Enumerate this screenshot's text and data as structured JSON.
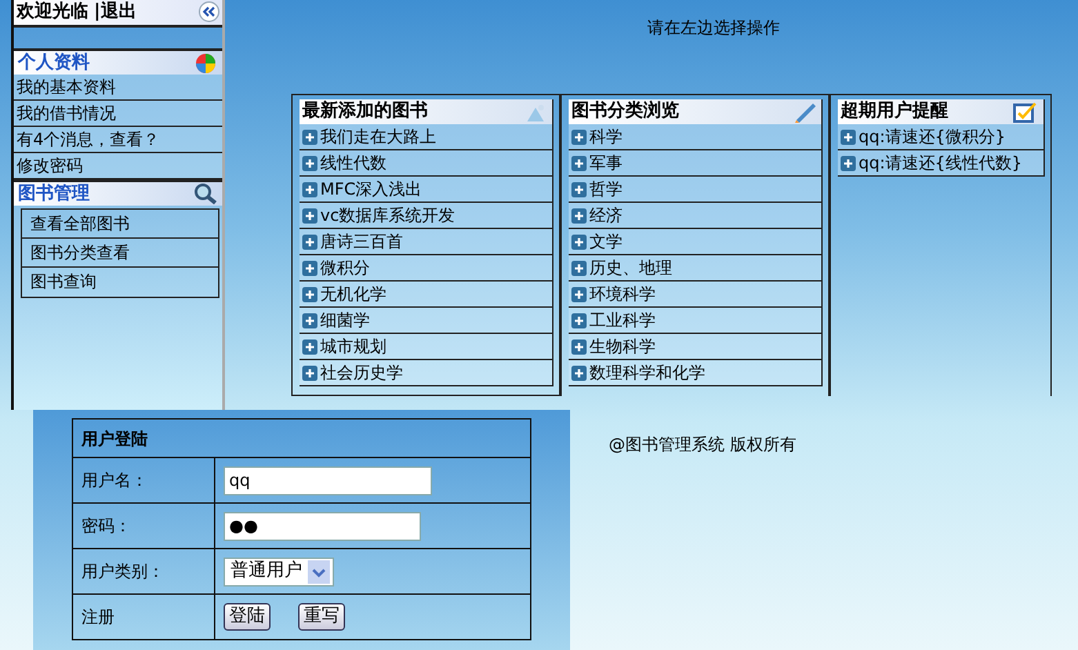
{
  "sidebar": {
    "header": {
      "welcome": "欢迎光临",
      "separator": "|",
      "logout": "退出"
    },
    "sections": [
      {
        "title": "个人资料",
        "kind": "plain",
        "items": [
          "我的基本资料",
          "我的借书情况",
          "有4个消息，查看？",
          "修改密码"
        ]
      },
      {
        "title": "图书管理",
        "kind": "boxed",
        "items": [
          "查看全部图书",
          "图书分类查看",
          "图书查询"
        ]
      }
    ]
  },
  "main": {
    "hint": "请在左边选择操作",
    "panels": [
      {
        "title": "最新添加的图书",
        "items": [
          "我们走在大路上",
          "线性代数",
          "MFC深入浅出",
          "vc数据库系统开发",
          "唐诗三百首",
          "微积分",
          "无机化学",
          "细菌学",
          "城市规划",
          "社会历史学"
        ]
      },
      {
        "title": "图书分类浏览",
        "items": [
          "科学",
          "军事",
          "哲学",
          "经济",
          "文学",
          "历史、地理",
          "环境科学",
          "工业科学",
          "生物科学",
          "数理科学和化学"
        ]
      },
      {
        "title": "超期用户提醒",
        "items": [
          "qq:请速还{微积分}",
          "qq:请速还{线性代数}"
        ]
      }
    ]
  },
  "login": {
    "title": "用户登陆",
    "fields": [
      {
        "label": "用户名：",
        "kind": "text",
        "value": "qq"
      },
      {
        "label": "密码：",
        "kind": "password",
        "value": "●●"
      },
      {
        "label": "用户类别：",
        "kind": "select",
        "value": "普通用户"
      }
    ],
    "footer_label": "注册",
    "buttons": [
      "登陆",
      "重写"
    ]
  },
  "copyright": "@图书管理系统 版权所有"
}
